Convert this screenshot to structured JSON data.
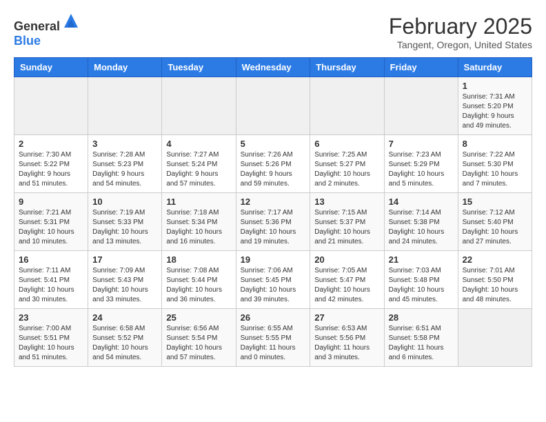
{
  "header": {
    "logo": {
      "text_general": "General",
      "text_blue": "Blue"
    },
    "title": "February 2025",
    "subtitle": "Tangent, Oregon, United States"
  },
  "weekdays": [
    "Sunday",
    "Monday",
    "Tuesday",
    "Wednesday",
    "Thursday",
    "Friday",
    "Saturday"
  ],
  "weeks": [
    [
      {
        "day": "",
        "info": ""
      },
      {
        "day": "",
        "info": ""
      },
      {
        "day": "",
        "info": ""
      },
      {
        "day": "",
        "info": ""
      },
      {
        "day": "",
        "info": ""
      },
      {
        "day": "",
        "info": ""
      },
      {
        "day": "1",
        "info": "Sunrise: 7:31 AM\nSunset: 5:20 PM\nDaylight: 9 hours\nand 49 minutes."
      }
    ],
    [
      {
        "day": "2",
        "info": "Sunrise: 7:30 AM\nSunset: 5:22 PM\nDaylight: 9 hours\nand 51 minutes."
      },
      {
        "day": "3",
        "info": "Sunrise: 7:28 AM\nSunset: 5:23 PM\nDaylight: 9 hours\nand 54 minutes."
      },
      {
        "day": "4",
        "info": "Sunrise: 7:27 AM\nSunset: 5:24 PM\nDaylight: 9 hours\nand 57 minutes."
      },
      {
        "day": "5",
        "info": "Sunrise: 7:26 AM\nSunset: 5:26 PM\nDaylight: 9 hours\nand 59 minutes."
      },
      {
        "day": "6",
        "info": "Sunrise: 7:25 AM\nSunset: 5:27 PM\nDaylight: 10 hours\nand 2 minutes."
      },
      {
        "day": "7",
        "info": "Sunrise: 7:23 AM\nSunset: 5:29 PM\nDaylight: 10 hours\nand 5 minutes."
      },
      {
        "day": "8",
        "info": "Sunrise: 7:22 AM\nSunset: 5:30 PM\nDaylight: 10 hours\nand 7 minutes."
      }
    ],
    [
      {
        "day": "9",
        "info": "Sunrise: 7:21 AM\nSunset: 5:31 PM\nDaylight: 10 hours\nand 10 minutes."
      },
      {
        "day": "10",
        "info": "Sunrise: 7:19 AM\nSunset: 5:33 PM\nDaylight: 10 hours\nand 13 minutes."
      },
      {
        "day": "11",
        "info": "Sunrise: 7:18 AM\nSunset: 5:34 PM\nDaylight: 10 hours\nand 16 minutes."
      },
      {
        "day": "12",
        "info": "Sunrise: 7:17 AM\nSunset: 5:36 PM\nDaylight: 10 hours\nand 19 minutes."
      },
      {
        "day": "13",
        "info": "Sunrise: 7:15 AM\nSunset: 5:37 PM\nDaylight: 10 hours\nand 21 minutes."
      },
      {
        "day": "14",
        "info": "Sunrise: 7:14 AM\nSunset: 5:38 PM\nDaylight: 10 hours\nand 24 minutes."
      },
      {
        "day": "15",
        "info": "Sunrise: 7:12 AM\nSunset: 5:40 PM\nDaylight: 10 hours\nand 27 minutes."
      }
    ],
    [
      {
        "day": "16",
        "info": "Sunrise: 7:11 AM\nSunset: 5:41 PM\nDaylight: 10 hours\nand 30 minutes."
      },
      {
        "day": "17",
        "info": "Sunrise: 7:09 AM\nSunset: 5:43 PM\nDaylight: 10 hours\nand 33 minutes."
      },
      {
        "day": "18",
        "info": "Sunrise: 7:08 AM\nSunset: 5:44 PM\nDaylight: 10 hours\nand 36 minutes."
      },
      {
        "day": "19",
        "info": "Sunrise: 7:06 AM\nSunset: 5:45 PM\nDaylight: 10 hours\nand 39 minutes."
      },
      {
        "day": "20",
        "info": "Sunrise: 7:05 AM\nSunset: 5:47 PM\nDaylight: 10 hours\nand 42 minutes."
      },
      {
        "day": "21",
        "info": "Sunrise: 7:03 AM\nSunset: 5:48 PM\nDaylight: 10 hours\nand 45 minutes."
      },
      {
        "day": "22",
        "info": "Sunrise: 7:01 AM\nSunset: 5:50 PM\nDaylight: 10 hours\nand 48 minutes."
      }
    ],
    [
      {
        "day": "23",
        "info": "Sunrise: 7:00 AM\nSunset: 5:51 PM\nDaylight: 10 hours\nand 51 minutes."
      },
      {
        "day": "24",
        "info": "Sunrise: 6:58 AM\nSunset: 5:52 PM\nDaylight: 10 hours\nand 54 minutes."
      },
      {
        "day": "25",
        "info": "Sunrise: 6:56 AM\nSunset: 5:54 PM\nDaylight: 10 hours\nand 57 minutes."
      },
      {
        "day": "26",
        "info": "Sunrise: 6:55 AM\nSunset: 5:55 PM\nDaylight: 11 hours\nand 0 minutes."
      },
      {
        "day": "27",
        "info": "Sunrise: 6:53 AM\nSunset: 5:56 PM\nDaylight: 11 hours\nand 3 minutes."
      },
      {
        "day": "28",
        "info": "Sunrise: 6:51 AM\nSunset: 5:58 PM\nDaylight: 11 hours\nand 6 minutes."
      },
      {
        "day": "",
        "info": ""
      }
    ]
  ]
}
